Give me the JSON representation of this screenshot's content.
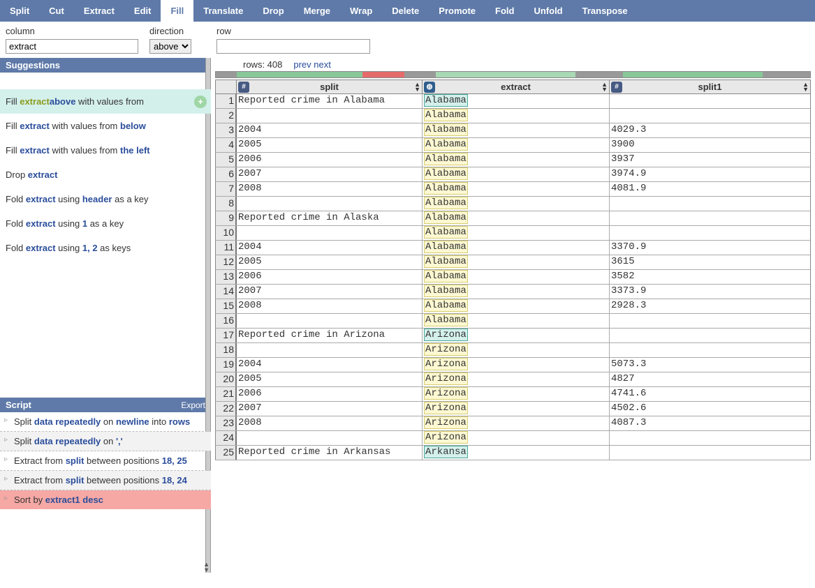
{
  "toolbar": {
    "items": [
      "Split",
      "Cut",
      "Extract",
      "Edit",
      "Fill",
      "Translate",
      "Drop",
      "Merge",
      "Wrap",
      "Delete",
      "Promote",
      "Fold",
      "Unfold",
      "Transpose"
    ],
    "active": "Fill"
  },
  "params": {
    "column_label": "column",
    "column_value": "extract",
    "direction_label": "direction",
    "direction_value": "above",
    "row_label": "row",
    "row_value": ""
  },
  "suggestions": {
    "header": "Suggestions",
    "items": [
      {
        "pre": "Fill ",
        "kw2": "extract",
        "mid": " with values from ",
        "kw": "above",
        "highlight": true,
        "plus": true
      },
      {
        "pre": "Fill ",
        "kw": "extract",
        "mid": " with values from ",
        "kw3": "below"
      },
      {
        "pre": "Fill ",
        "kw": "extract",
        "mid": " with values from ",
        "kw3": "the left"
      },
      {
        "pre": "Drop ",
        "kw": "extract"
      },
      {
        "pre": "Fold ",
        "kw": "extract",
        "mid": " using ",
        "kw3": "header",
        "post": " as a key"
      },
      {
        "pre": "Fold ",
        "kw": "extract",
        "mid": " using ",
        "kw3": "1",
        "post": " as a key"
      },
      {
        "pre": "Fold ",
        "kw": "extract",
        "mid": " using ",
        "kw3": "1, 2",
        "post": " as keys"
      }
    ]
  },
  "script": {
    "header": "Script",
    "export": "Export",
    "items": [
      {
        "text": [
          "Split ",
          "data repeatedly",
          " on ",
          "newline",
          " into ",
          "rows"
        ],
        "bold": [
          1,
          3,
          5
        ],
        "alt": false
      },
      {
        "text": [
          "Split ",
          "data repeatedly",
          " on ",
          "','"
        ],
        "bold": [
          1,
          3
        ],
        "alt": true
      },
      {
        "text": [
          "Extract from ",
          "split",
          " between positions ",
          "18, 25"
        ],
        "bold": [
          1,
          3
        ],
        "alt": false
      },
      {
        "text": [
          "Extract from ",
          "split",
          " between positions ",
          "18, 24"
        ],
        "bold": [
          1,
          3
        ],
        "alt": true
      },
      {
        "text": [
          "Sort by ",
          "extract1 desc"
        ],
        "bold": [
          1
        ],
        "err": true
      }
    ]
  },
  "table": {
    "row_count_label": "rows: 408",
    "prev": "prev",
    "next": "next",
    "columns": [
      "split",
      "extract",
      "split1"
    ],
    "rows": [
      {
        "n": 1,
        "split": "Reported crime in Alabama",
        "extract": "Alabama",
        "split1": "",
        "ex_hl": "cyan"
      },
      {
        "n": 2,
        "split": "",
        "extract": "Alabama",
        "split1": "",
        "ex_hl": "yellow"
      },
      {
        "n": 3,
        "split": "2004",
        "extract": "Alabama",
        "split1": "4029.3",
        "ex_hl": "yellow"
      },
      {
        "n": 4,
        "split": "2005",
        "extract": "Alabama",
        "split1": "3900",
        "ex_hl": "yellow"
      },
      {
        "n": 5,
        "split": "2006",
        "extract": "Alabama",
        "split1": "3937",
        "ex_hl": "yellow"
      },
      {
        "n": 6,
        "split": "2007",
        "extract": "Alabama",
        "split1": "3974.9",
        "ex_hl": "yellow"
      },
      {
        "n": 7,
        "split": "2008",
        "extract": "Alabama",
        "split1": "4081.9",
        "ex_hl": "yellow"
      },
      {
        "n": 8,
        "split": "",
        "extract": "Alabama",
        "split1": "",
        "ex_hl": "yellow"
      },
      {
        "n": 9,
        "split": "Reported crime in Alaska",
        "extract": "Alabama",
        "split1": "",
        "ex_hl": "yellow"
      },
      {
        "n": 10,
        "split": "",
        "extract": "Alabama",
        "split1": "",
        "ex_hl": "yellow"
      },
      {
        "n": 11,
        "split": "2004",
        "extract": "Alabama",
        "split1": "3370.9",
        "ex_hl": "yellow"
      },
      {
        "n": 12,
        "split": "2005",
        "extract": "Alabama",
        "split1": "3615",
        "ex_hl": "yellow"
      },
      {
        "n": 13,
        "split": "2006",
        "extract": "Alabama",
        "split1": "3582",
        "ex_hl": "yellow"
      },
      {
        "n": 14,
        "split": "2007",
        "extract": "Alabama",
        "split1": "3373.9",
        "ex_hl": "yellow"
      },
      {
        "n": 15,
        "split": "2008",
        "extract": "Alabama",
        "split1": "2928.3",
        "ex_hl": "yellow"
      },
      {
        "n": 16,
        "split": "",
        "extract": "Alabama",
        "split1": "",
        "ex_hl": "yellow"
      },
      {
        "n": 17,
        "split": "Reported crime in Arizona",
        "extract": "Arizona",
        "split1": "",
        "ex_hl": "cyan"
      },
      {
        "n": 18,
        "split": "",
        "extract": "Arizona",
        "split1": "",
        "ex_hl": "yellow"
      },
      {
        "n": 19,
        "split": "2004",
        "extract": "Arizona",
        "split1": "5073.3",
        "ex_hl": "yellow"
      },
      {
        "n": 20,
        "split": "2005",
        "extract": "Arizona",
        "split1": "4827",
        "ex_hl": "yellow"
      },
      {
        "n": 21,
        "split": "2006",
        "extract": "Arizona",
        "split1": "4741.6",
        "ex_hl": "yellow"
      },
      {
        "n": 22,
        "split": "2007",
        "extract": "Arizona",
        "split1": "4502.6",
        "ex_hl": "yellow"
      },
      {
        "n": 23,
        "split": "2008",
        "extract": "Arizona",
        "split1": "4087.3",
        "ex_hl": "yellow"
      },
      {
        "n": 24,
        "split": "",
        "extract": "Arizona",
        "split1": "",
        "ex_hl": "yellow"
      },
      {
        "n": 25,
        "split": "Reported crime in Arkansas",
        "extract": "Arkansa",
        "split1": "",
        "ex_hl": "cyan"
      }
    ]
  }
}
